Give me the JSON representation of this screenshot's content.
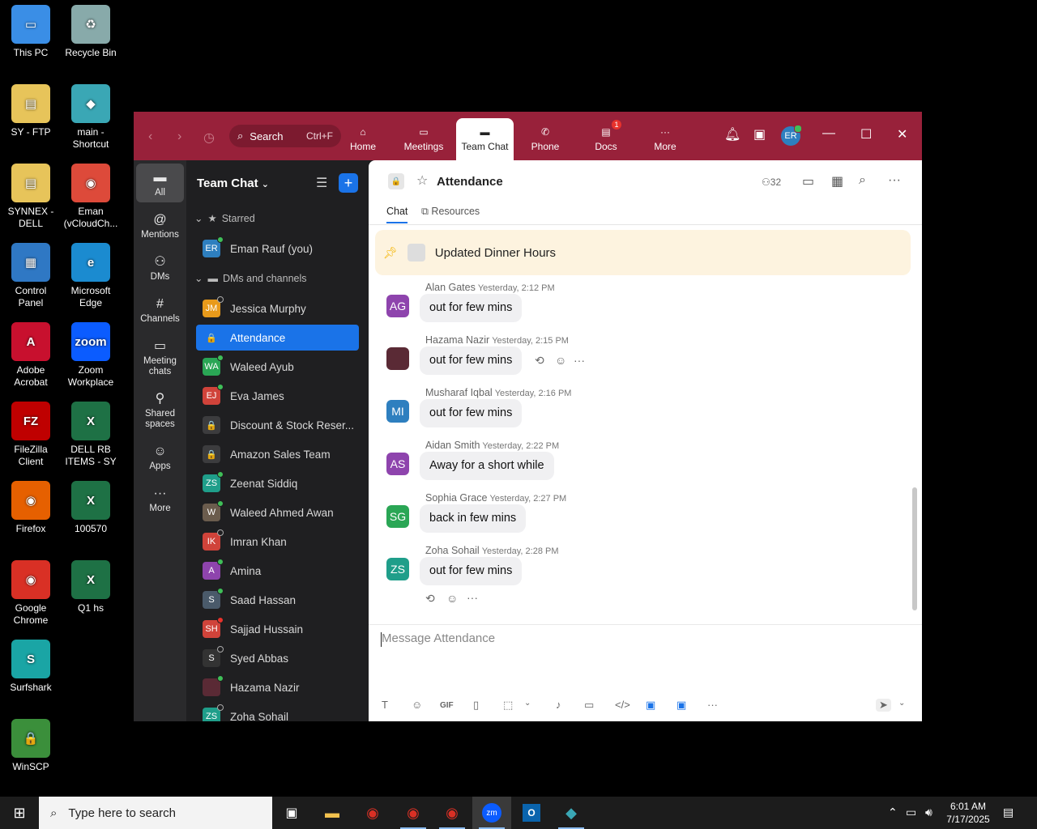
{
  "desktop": {
    "icons": [
      {
        "label": "This PC",
        "color": "#3a8ee6",
        "glyph": "▭"
      },
      {
        "label": "Recycle Bin",
        "color": "#8aa",
        "glyph": "♻"
      },
      {
        "label": "SY - FTP",
        "color": "#e7c45a",
        "glyph": "▤"
      },
      {
        "label": "main -\nShortcut",
        "color": "#3aa7b5",
        "glyph": "◆"
      },
      {
        "label": "SYNNEX -\nDELL",
        "color": "#e7c45a",
        "glyph": "▤"
      },
      {
        "label": "Eman\n(vCloudCh...",
        "color": "#dd4a3a",
        "glyph": "◉"
      },
      {
        "label": "Control\nPanel",
        "color": "#2f78c4",
        "glyph": "▦"
      },
      {
        "label": "Microsoft\nEdge",
        "color": "#1b8bd0",
        "glyph": "e"
      },
      {
        "label": "Adobe\nAcrobat",
        "color": "#c8102e",
        "glyph": "A"
      },
      {
        "label": "Zoom\nWorkplace",
        "color": "#0b5cff",
        "glyph": "zoom"
      },
      {
        "label": "FileZilla\nClient",
        "color": "#bf0000",
        "glyph": "FZ"
      },
      {
        "label": "DELL RB\nITEMS - SY",
        "color": "#1e7145",
        "glyph": "X"
      },
      {
        "label": "Firefox",
        "color": "#e66000",
        "glyph": "◉"
      },
      {
        "label": "100570",
        "color": "#1e7145",
        "glyph": "X"
      },
      {
        "label": "Google\nChrome",
        "color": "#d93025",
        "glyph": "◉"
      },
      {
        "label": "Q1 hs",
        "color": "#1e7145",
        "glyph": "X"
      },
      {
        "label": "Surfshark",
        "color": "#1aa5a5",
        "glyph": "S"
      },
      {
        "label": "WinSCP",
        "color": "#3b8f3b",
        "glyph": "🔒"
      }
    ]
  },
  "titlebar": {
    "search_label": "Search",
    "search_shortcut": "Ctrl+F",
    "nav": [
      {
        "label": "Home",
        "icon": "home-icon"
      },
      {
        "label": "Meetings",
        "icon": "video-icon"
      },
      {
        "label": "Team Chat",
        "icon": "chat-icon"
      },
      {
        "label": "Phone",
        "icon": "phone-icon"
      },
      {
        "label": "Docs",
        "icon": "docs-icon",
        "badge": "1"
      },
      {
        "label": "More",
        "icon": "more-icon"
      }
    ],
    "user_initials": "ER"
  },
  "rail": [
    {
      "label": "All",
      "glyph": "▬"
    },
    {
      "label": "Mentions",
      "glyph": "@"
    },
    {
      "label": "DMs",
      "glyph": "⚇"
    },
    {
      "label": "Channels",
      "glyph": "#"
    },
    {
      "label": "Meeting\nchats",
      "glyph": "▭"
    },
    {
      "label": "Shared\nspaces",
      "glyph": "⚲"
    },
    {
      "label": "Apps",
      "glyph": "☺"
    },
    {
      "label": "More",
      "glyph": "···"
    }
  ],
  "chatlist": {
    "title": "Team Chat",
    "starred_label": "Starred",
    "dms_label": "DMs and channels",
    "starred": [
      {
        "name": "Eman Rauf (you)",
        "initials": "ER",
        "color": "#2e7fbf",
        "status": "on"
      }
    ],
    "items": [
      {
        "name": "Jessica Murphy",
        "initials": "JM",
        "color": "#e89a1b",
        "status": "off"
      },
      {
        "name": "Attendance",
        "initials": "🔒",
        "color": "#1a73e8",
        "status": "",
        "selected": true
      },
      {
        "name": "Waleed Ayub",
        "initials": "WA",
        "color": "#2aa655",
        "status": "on"
      },
      {
        "name": "Eva James",
        "initials": "EJ",
        "color": "#d0433a",
        "status": "on"
      },
      {
        "name": "Discount & Stock Reser...",
        "initials": "🔒",
        "color": "#3c3c3e",
        "status": ""
      },
      {
        "name": "Amazon Sales Team",
        "initials": "🔒",
        "color": "#3c3c3e",
        "status": ""
      },
      {
        "name": "Zeenat Siddiq",
        "initials": "ZS",
        "color": "#1f9e8a",
        "status": "on"
      },
      {
        "name": "Waleed Ahmed Awan",
        "initials": "W",
        "color": "#6b5c4d",
        "status": "on"
      },
      {
        "name": "Imran Khan",
        "initials": "IK",
        "color": "#d0433a",
        "status": "off"
      },
      {
        "name": "Amina",
        "initials": "A",
        "color": "#8e44ad",
        "status": "on"
      },
      {
        "name": "Saad Hassan",
        "initials": "S",
        "color": "#4a5a6a",
        "status": "on"
      },
      {
        "name": "Sajjad Hussain",
        "initials": "SH",
        "color": "#d0433a",
        "status": "phone"
      },
      {
        "name": "Syed Abbas",
        "initials": "S",
        "color": "#333",
        "status": "off"
      },
      {
        "name": "Hazama Nazir",
        "initials": "",
        "color": "#5a2a35",
        "status": "on"
      },
      {
        "name": "Zoha Sohail",
        "initials": "ZS",
        "color": "#1f9e8a",
        "status": "off"
      }
    ]
  },
  "channel": {
    "name": "Attendance",
    "members": "32",
    "tabs": [
      "Chat",
      "Resources"
    ],
    "pinned": "Updated Dinner Hours",
    "messages": [
      {
        "sender": "Alan Gates",
        "time": "Yesterday, 2:12 PM",
        "text": "out for few mins",
        "initials": "AG",
        "color": "#8e44ad"
      },
      {
        "sender": "Hazama Nazir",
        "time": "Yesterday, 2:15 PM",
        "text": "out for few mins",
        "initials": "",
        "color": "#5a2a35"
      },
      {
        "sender": "Musharaf Iqbal",
        "time": "Yesterday, 2:16 PM",
        "text": "out for few mins",
        "initials": "MI",
        "color": "#2e7fbf"
      },
      {
        "sender": "Aidan Smith",
        "time": "Yesterday, 2:22 PM",
        "text": "Away for a short while",
        "initials": "AS",
        "color": "#8e44ad"
      },
      {
        "sender": "Sophia Grace",
        "time": "Yesterday, 2:27 PM",
        "text": "back in few mins",
        "initials": "SG",
        "color": "#2aa655"
      },
      {
        "sender": "Zoha Sohail",
        "time": "Yesterday, 2:28 PM",
        "text": "out for few mins",
        "initials": "ZS",
        "color": "#1f9e8a"
      }
    ],
    "composer_placeholder": "Message Attendance"
  },
  "taskbar": {
    "search_placeholder": "Type here to search",
    "time": "6:01 AM",
    "date": "7/17/2025"
  }
}
